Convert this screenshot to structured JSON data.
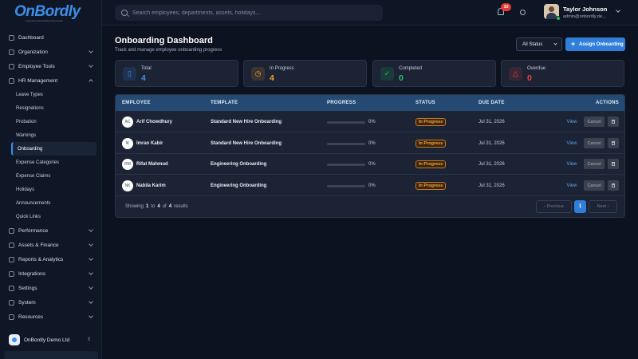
{
  "brand": {
    "logo_text": "OnBordly",
    "logo_tagline": "Automated Onboarding Framework"
  },
  "sidebar": {
    "items": [
      {
        "label": "Dashboard"
      },
      {
        "label": "Organization"
      },
      {
        "label": "Employee Tools"
      },
      {
        "label": "HR Management"
      },
      {
        "label": "Performance"
      },
      {
        "label": "Assets & Finance"
      },
      {
        "label": "Reports & Analytics"
      },
      {
        "label": "Integrations"
      },
      {
        "label": "Settings"
      },
      {
        "label": "System"
      },
      {
        "label": "Resources"
      }
    ],
    "hr_subitems": [
      {
        "label": "Leave Types"
      },
      {
        "label": "Resignations"
      },
      {
        "label": "Probation"
      },
      {
        "label": "Warnings"
      },
      {
        "label": "Onboarding"
      },
      {
        "label": "Expense Categories"
      },
      {
        "label": "Expense Claims"
      },
      {
        "label": "Holidays"
      },
      {
        "label": "Announcements"
      },
      {
        "label": "Quick Links"
      }
    ],
    "org_name": "OnBordly Demo Ltd",
    "org_sort_glyph": "⇕"
  },
  "topbar": {
    "search_placeholder": "Search employees, departments, assets, holidays...",
    "notification_count": "10",
    "user_name": "Taylor Johnson",
    "user_email": "admin@onbordly.de..."
  },
  "page": {
    "title": "Onboarding Dashboard",
    "subtitle": "Track and manage employee onboarding progress",
    "status_filter": "All Status",
    "assign_button": "Assign Onboarding",
    "assign_plus": "+"
  },
  "stats": [
    {
      "label": "Total",
      "value": "4",
      "color": "#3d8fe8",
      "icon": "clipboard-icon",
      "glyph": "▯"
    },
    {
      "label": "In Progress",
      "value": "4",
      "color": "#f0a030",
      "icon": "clock-icon",
      "glyph": "◷"
    },
    {
      "label": "Completed",
      "value": "0",
      "color": "#22c55e",
      "icon": "check-circle-icon",
      "glyph": "✓"
    },
    {
      "label": "Overdue",
      "value": "0",
      "color": "#ef4444",
      "icon": "alert-triangle-icon",
      "glyph": "△"
    }
  ],
  "table": {
    "headers": {
      "employee": "EMPLOYEE",
      "template": "TEMPLATE",
      "progress": "PROGRESS",
      "status": "STATUS",
      "due_date": "DUE DATE",
      "actions": "ACTIONS"
    },
    "rows": [
      {
        "initials": "AC",
        "name": "Arif Chowdhury",
        "template": "Standard New Hire Onboarding",
        "progress": "0%",
        "progress_value": 0,
        "status": "In Progress",
        "due": "Jul 31, 2026",
        "view": "View",
        "cancel": "Cancel"
      },
      {
        "initials": "IK",
        "name": "Imran Kabir",
        "template": "Standard New Hire Onboarding",
        "progress": "0%",
        "progress_value": 0,
        "status": "In Progress",
        "due": "Jul 31, 2026",
        "view": "View",
        "cancel": "Cancel"
      },
      {
        "initials": "RM",
        "name": "Rifat Mahmud",
        "template": "Engineering Onboarding",
        "progress": "0%",
        "progress_value": 0,
        "status": "In Progress",
        "due": "Jul 31, 2026",
        "view": "View",
        "cancel": "Cancel"
      },
      {
        "initials": "NK",
        "name": "Nabila Karim",
        "template": "Engineering Onboarding",
        "progress": "0%",
        "progress_value": 0,
        "status": "In Progress",
        "due": "Jul 31, 2026",
        "view": "View",
        "cancel": "Cancel"
      }
    ],
    "footer": {
      "showing": "Showing",
      "from": "1",
      "to_word": "to",
      "to": "4",
      "of_word": "of",
      "total": "4",
      "results": "results"
    },
    "pagination": {
      "prev": "‹  Previous",
      "page": "1",
      "next": "Next  ›"
    }
  }
}
